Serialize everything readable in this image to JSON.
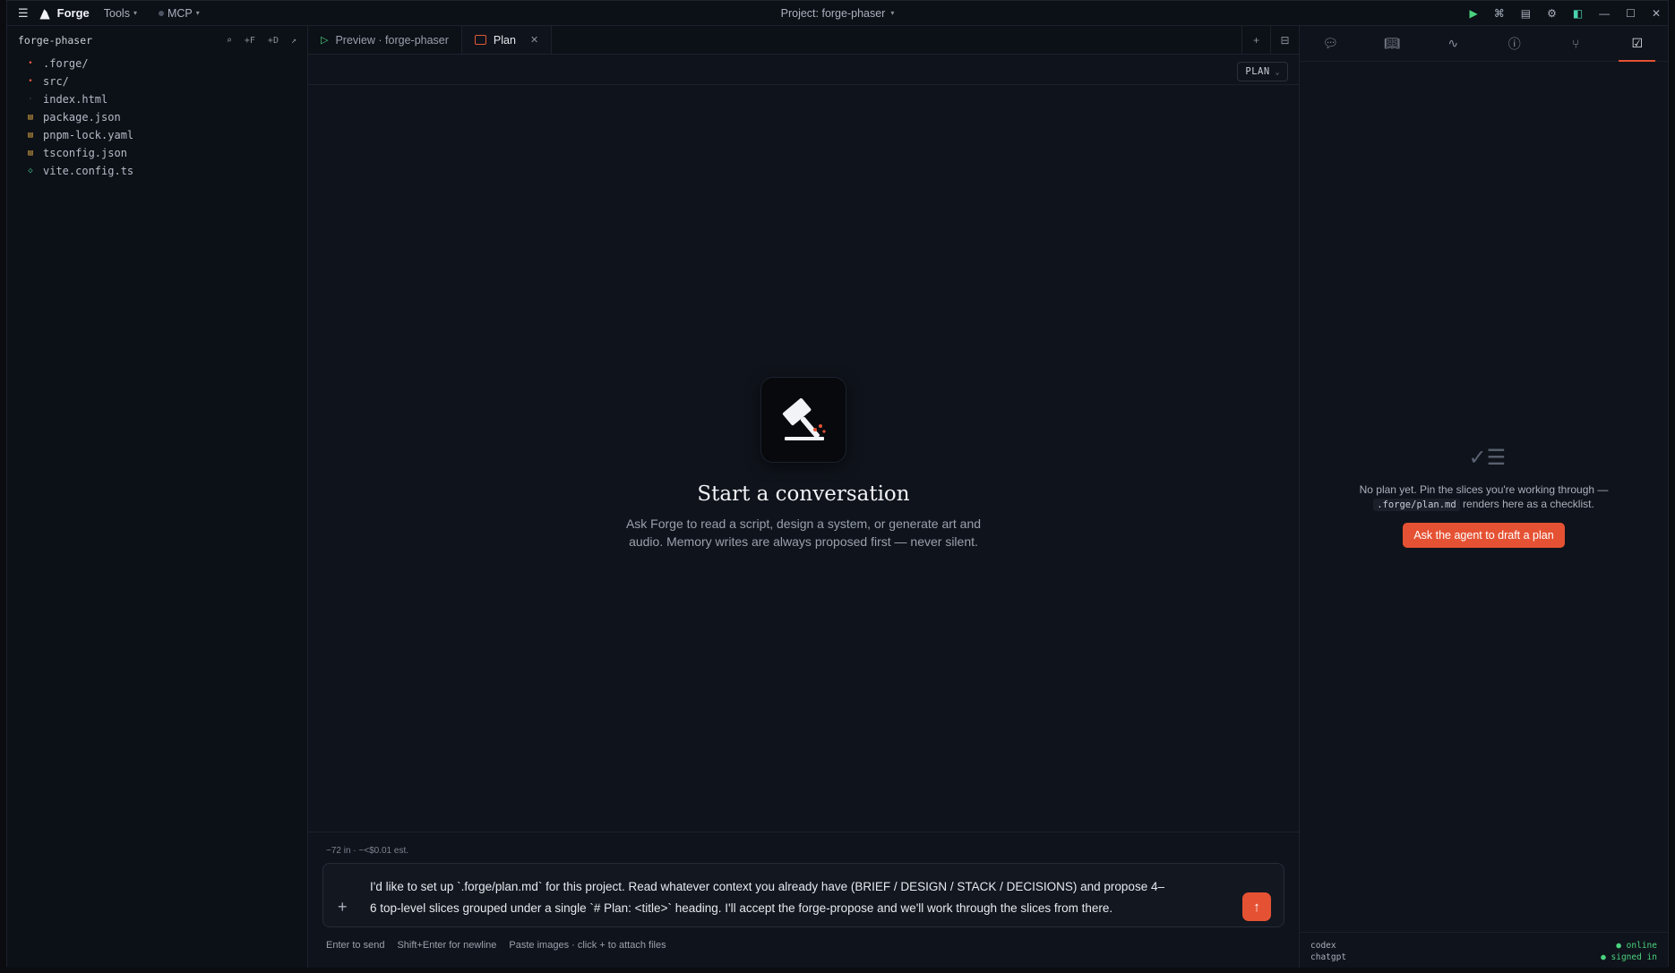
{
  "titlebar": {
    "app_name": "Forge",
    "menu_tools": "Tools",
    "menu_mcp": "MCP",
    "project_label": "Project: forge-phaser"
  },
  "sidebar": {
    "title": "forge-phaser",
    "actions": [
      "⌕",
      "+F",
      "+D",
      "↗"
    ],
    "files": [
      {
        "name": ".forge/",
        "type": "folder"
      },
      {
        "name": "src/",
        "type": "folder"
      },
      {
        "name": "index.html",
        "type": "file"
      },
      {
        "name": "package.json",
        "type": "json"
      },
      {
        "name": "pnpm-lock.yaml",
        "type": "json"
      },
      {
        "name": "tsconfig.json",
        "type": "json"
      },
      {
        "name": "vite.config.ts",
        "type": "ts"
      }
    ]
  },
  "tabs": {
    "preview": "Preview · forge-phaser",
    "plan": "Plan"
  },
  "plan_badge": "PLAN",
  "empty_state": {
    "title": "Start a conversation",
    "line1": "Ask Forge to read a script, design a system, or generate art and",
    "line2": "audio. Memory writes are always proposed first — never silent."
  },
  "composer": {
    "token_estimate": "~72 in · ~<$0.01 est.",
    "text_line1": "I'd like to set up `.forge/plan.md` for this project. Read whatever context you already have (BRIEF / DESIGN / STACK / DECISIONS) and propose 4–",
    "text_line2": "6 top-level slices grouped under a single `# Plan: <title>` heading. I'll accept the forge-propose and we'll work through the slices from there.",
    "hint_send": "Enter to send",
    "hint_newline": "Shift+Enter for newline",
    "hint_attach": "Paste images · click + to attach files"
  },
  "right_panel": {
    "empty_line1": "No plan yet. Pin the slices you're working through —",
    "empty_code": ".forge/plan.md",
    "empty_line2": "renders here as a checklist.",
    "button": "Ask the agent to draft a plan",
    "status": [
      {
        "name": "codex",
        "state": "● online"
      },
      {
        "name": "chatgpt",
        "state": "● signed in"
      }
    ]
  },
  "colors": {
    "accent": "#e55233",
    "success": "#4ad37e",
    "background": "#0f131b"
  }
}
